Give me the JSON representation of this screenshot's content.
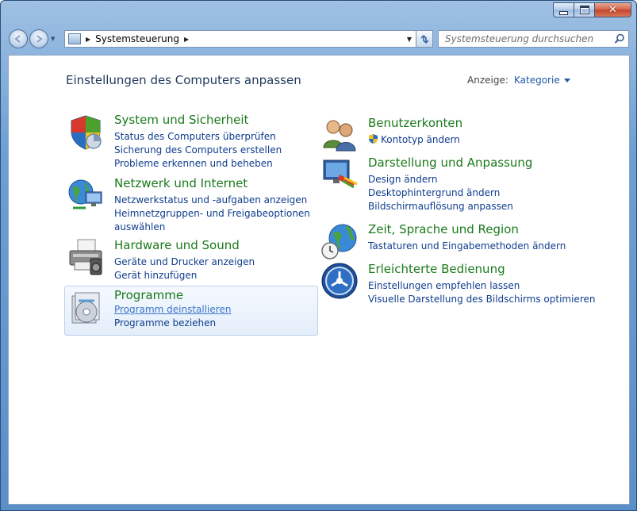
{
  "window": {
    "caption_buttons": {
      "minimize": "minimize-icon",
      "maximize": "maximize-icon",
      "close": "✕"
    }
  },
  "nav": {
    "back_icon": "arrow-left-icon",
    "forward_icon": "arrow-right-icon",
    "address_segment": "Systemsteuerung",
    "search_placeholder": "Systemsteuerung durchsuchen"
  },
  "main": {
    "title": "Einstellungen des Computers anpassen",
    "view_by_label": "Anzeige:",
    "view_by_value": "Kategorie"
  },
  "categories_left": [
    {
      "title": "System und Sicherheit",
      "icon": "shield-icon",
      "links": [
        "Status des Computers überprüfen",
        "Sicherung des Computers erstellen",
        "Probleme erkennen und beheben"
      ]
    },
    {
      "title": "Netzwerk und Internet",
      "icon": "network-globe-icon",
      "links": [
        "Netzwerkstatus und -aufgaben anzeigen",
        "Heimnetzgruppen- und Freigabeoptionen",
        "auswählen"
      ]
    },
    {
      "title": "Hardware und Sound",
      "icon": "printer-icon",
      "links": [
        "Geräte und Drucker anzeigen",
        "Gerät hinzufügen"
      ]
    },
    {
      "title": "Programme",
      "icon": "programs-disc-icon",
      "links": [
        "Programm deinstallieren",
        "Programme beziehen"
      ]
    }
  ],
  "categories_right": [
    {
      "title": "Benutzerkonten",
      "icon": "users-icon",
      "links": [
        "Kontotyp ändern"
      ]
    },
    {
      "title": "Darstellung und Anpassung",
      "icon": "display-paint-icon",
      "links": [
        "Design ändern",
        "Desktophintergrund ändern",
        "Bildschirmauflösung anpassen"
      ]
    },
    {
      "title": "Zeit, Sprache und Region",
      "icon": "globe-clock-icon",
      "links": [
        "Tastaturen und Eingabemethoden ändern"
      ]
    },
    {
      "title": "Erleichterte Bedienung",
      "icon": "accessibility-icon",
      "links": [
        "Einstellungen empfehlen lassen",
        "Visuelle Darstellung des Bildschirms optimieren"
      ]
    }
  ],
  "colors": {
    "category_title": "#1a7a1a",
    "link": "#0f3d8e",
    "hover_link": "#3a74c9",
    "title_text": "#1e395b"
  }
}
